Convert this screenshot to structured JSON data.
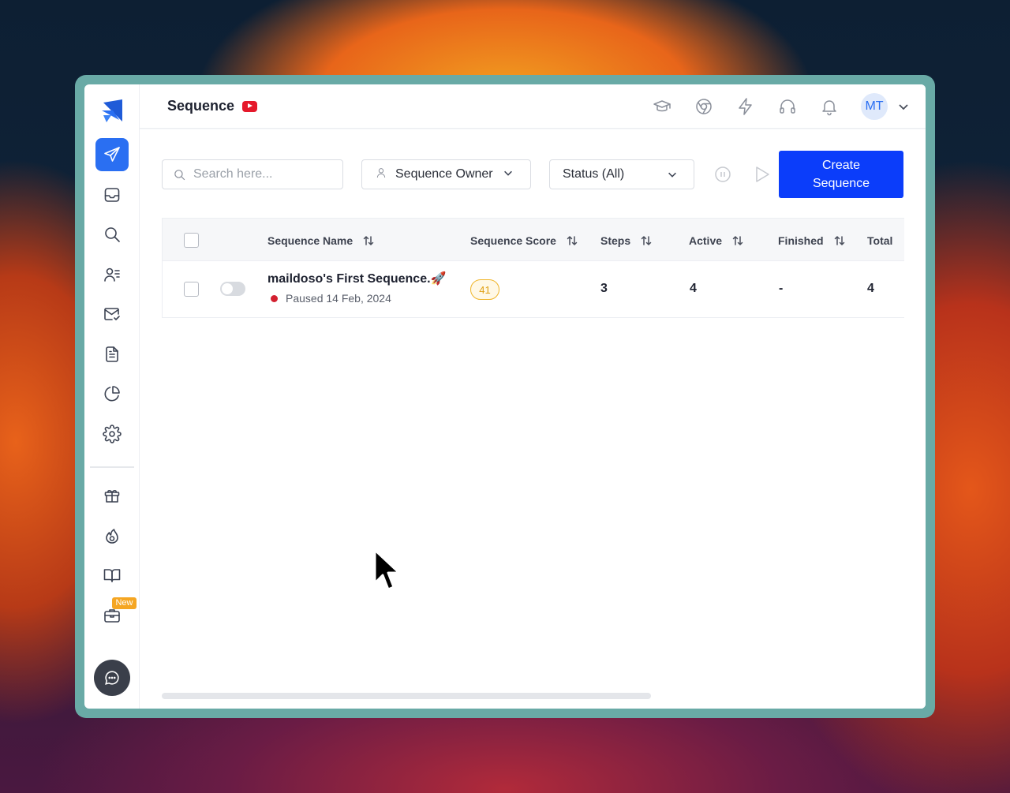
{
  "header": {
    "title": "Sequence",
    "avatar_initials": "MT"
  },
  "toolbar": {
    "search_placeholder": "Search here...",
    "owner_label": "Sequence Owner",
    "status_label": "Status (All)",
    "create_label": "Create Sequence"
  },
  "table": {
    "columns": [
      "Sequence Name",
      "Sequence Score",
      "Steps",
      "Active",
      "Finished",
      "Total"
    ],
    "rows": [
      {
        "name": "maildoso's First Sequence.🚀",
        "status": "Paused 14 Feb, 2024",
        "score": "41",
        "steps": "3",
        "active": "4",
        "finished": "-",
        "total": "4"
      }
    ]
  },
  "sidebar": {
    "new_badge": "New"
  },
  "colors": {
    "primary": "#0b3dfa",
    "nav_active": "#2a6ff2",
    "score": "#f0b52a",
    "paused": "#d32030",
    "frame": "#69aaa6"
  }
}
